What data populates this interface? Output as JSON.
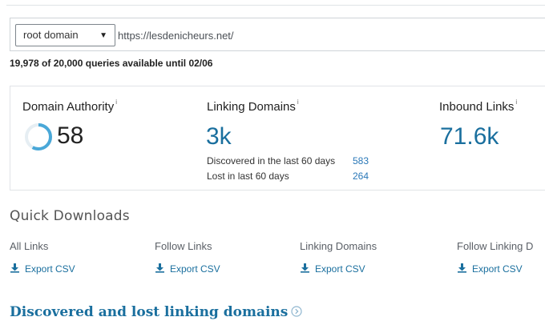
{
  "search": {
    "scope_selected": "root domain",
    "url_value": "https://lesdenicheurs.net/"
  },
  "quota": {
    "text": "19,978 of 20,000 queries available until 02/06"
  },
  "metrics": {
    "domain_authority": {
      "label": "Domain Authority",
      "info": "i",
      "value": "58",
      "ring_fraction": 0.58
    },
    "linking_domains": {
      "label": "Linking Domains",
      "info": "i",
      "value": "3k",
      "discovered_label": "Discovered in the last 60 days",
      "discovered_value": "583",
      "lost_label": "Lost in last 60 days",
      "lost_value": "264"
    },
    "inbound_links": {
      "label": "Inbound Links",
      "info": "i",
      "value": "71.6k"
    }
  },
  "quick_downloads": {
    "title": "Quick Downloads",
    "items": [
      {
        "label": "All Links",
        "button": "Export CSV"
      },
      {
        "label": "Follow Links",
        "button": "Export CSV"
      },
      {
        "label": "Linking Domains",
        "button": "Export CSV"
      },
      {
        "label": "Follow Linking D",
        "button": "Export CSV"
      }
    ]
  },
  "discovered_section": {
    "title": "Discovered and lost linking domains"
  },
  "colors": {
    "accent_blue": "#1a6f9e",
    "link_blue": "#2a78b8",
    "ring_blue": "#4aa8d8"
  },
  "icons": {
    "download": "download-icon",
    "dropdown": "caret-down-icon",
    "section_arrow": "circle-arrow-right-icon"
  }
}
